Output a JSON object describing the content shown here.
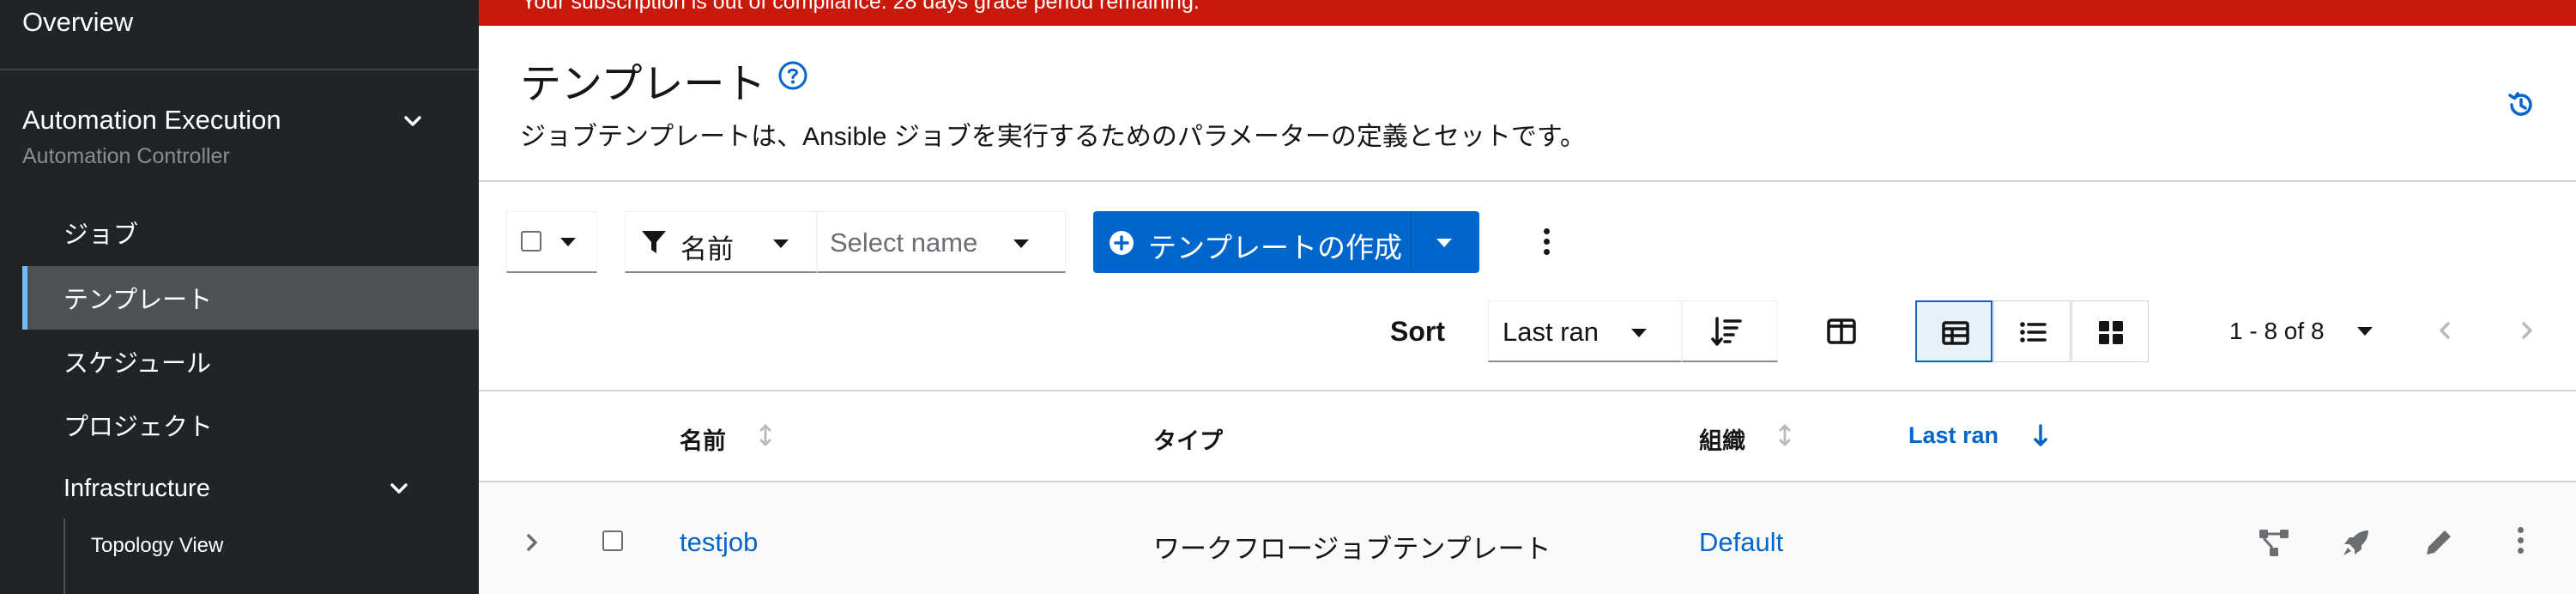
{
  "banner": {
    "text": "Your subscription is out of compliance. 28 days grace period remaining."
  },
  "sidebar": {
    "overview": "Overview",
    "section": {
      "title": "Automation Execution",
      "subtitle": "Automation Controller"
    },
    "items": [
      {
        "label": "ジョブ"
      },
      {
        "label": "テンプレート",
        "active": true
      },
      {
        "label": "スケジュール"
      },
      {
        "label": "プロジェクト"
      }
    ],
    "infrastructure": {
      "label": "Infrastructure"
    },
    "subitems": [
      {
        "label": "Topology View"
      }
    ]
  },
  "header": {
    "title": "テンプレート",
    "description": "ジョブテンプレートは、Ansible ジョブを実行するためのパラメーターの定義とセットです。",
    "help_icon": "help-circle-icon",
    "history_icon": "history-icon"
  },
  "toolbar": {
    "filter_attribute": "名前",
    "filter_placeholder": "Select name",
    "create_label": "テンプレートの作成",
    "sort_label": "Sort",
    "sort_value": "Last ran",
    "pagination": "1 - 8 of 8"
  },
  "table": {
    "columns": [
      {
        "label": "名前",
        "sortable": true
      },
      {
        "label": "タイプ",
        "sortable": false
      },
      {
        "label": "組織",
        "sortable": true
      },
      {
        "label": "Last ran",
        "sortable": true,
        "sorted": "desc"
      }
    ],
    "rows": [
      {
        "name": "testjob",
        "type": "ワークフロージョブテンプレート",
        "organization": "Default"
      }
    ]
  },
  "colors": {
    "sidebar_bg": "#212427",
    "banner_bg": "#c9190b",
    "primary": "#0066cc",
    "active_accent": "#73bcf7"
  }
}
